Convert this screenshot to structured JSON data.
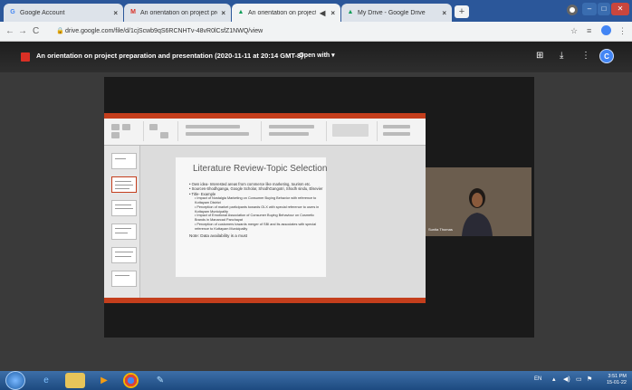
{
  "browser": {
    "tabs": [
      {
        "label": "Google Account",
        "icon": "google-icon",
        "active": false
      },
      {
        "label": "An orientation on project prepar",
        "icon": "gmail-icon",
        "active": false
      },
      {
        "label": "An orientation on project pr",
        "icon": "drive-icon",
        "active": true
      },
      {
        "label": "My Drive - Google Drive",
        "icon": "drive-icon",
        "active": false
      }
    ],
    "url": "drive.google.com/file/d/1cjScwb9qS6RCNHTv-48vR0lCsfZ1NWQ/view"
  },
  "viewer": {
    "title": "An orientation on project preparation and presentation (2020-11-11 at 20:14 GMT-8)",
    "open_with": "Open with",
    "avatar_letter": "C"
  },
  "slide": {
    "title": "Literature Review-Topic Selection",
    "bullets": [
      "• Own idea- Interested areas from commerce like marketing, tourism etc.",
      "• Sources-Shodhganga, Google Scholar, ShodhGangotri, Shodh sindu, Elsevier",
      "• Title- Example"
    ],
    "sub_bullets": [
      "• Impact of Nostalgia Marketing on Consumer Buying Behavior with reference to Kottayam District",
      "• Perception of market participants towards OLX with special reference to users in Kottayam Municipality",
      "• Impact of Emotional Association of Consumer Buying Behaviour on Cosmetic Brands in Manarcad Panchayat",
      "• Perception of customers towards merger of SBI and its associates with special reference to Kottayam Municipality"
    ],
    "note": "Note: Data availability is a must"
  },
  "participant": {
    "name": "Sunita Thomas"
  },
  "taskbar": {
    "lang": "EN",
    "time": "3:51 PM",
    "date": "15-01-22"
  }
}
